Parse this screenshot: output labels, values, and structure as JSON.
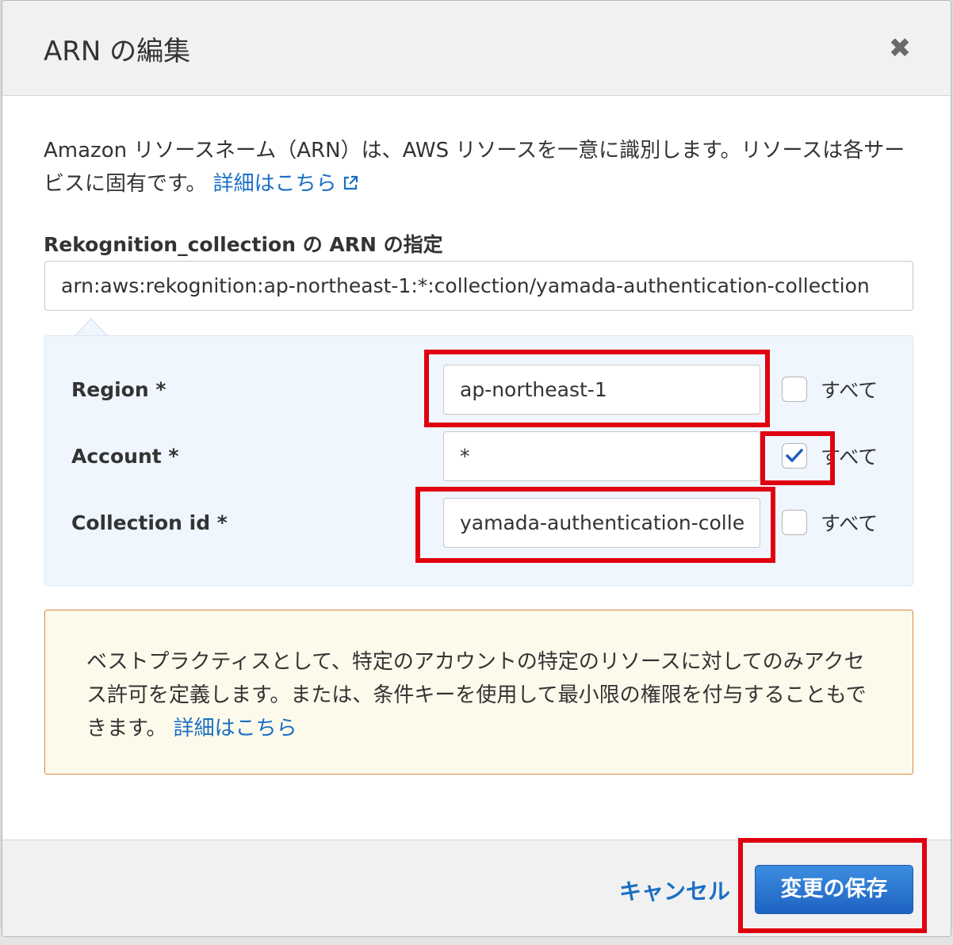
{
  "dialog": {
    "title": "ARN の編集",
    "close_symbol": "✖"
  },
  "description": {
    "text": "Amazon リソースネーム（ARN）は、AWS リソースを一意に識別します。リソースは各サービスに固有です。",
    "link_text": "詳細はこちら"
  },
  "arn_field": {
    "label": "Rekognition_collection の ARN の指定",
    "value": "arn:aws:rekognition:ap-northeast-1:*:collection/yamada-authentication-collection"
  },
  "rows": [
    {
      "label": "Region *",
      "value": "ap-northeast-1",
      "all_checked": false,
      "all_label": "すべて"
    },
    {
      "label": "Account *",
      "value": "*",
      "all_checked": true,
      "all_label": "すべて"
    },
    {
      "label": "Collection id *",
      "value": "yamada-authentication-colle",
      "all_checked": false,
      "all_label": "すべて"
    }
  ],
  "notice": {
    "text": "ベストプラクティスとして、特定のアカウントの特定のリソースに対してのみアクセス許可を定義します。または、条件キーを使用して最小限の権限を付与することもできます。",
    "link_text": "詳細はこちら"
  },
  "footer": {
    "cancel_label": "キャンセル",
    "save_label": "変更の保存"
  },
  "colors": {
    "highlight": "#e00010",
    "link": "#1a6fc4",
    "primary_button": "#1d63c2"
  },
  "icons": {
    "close": "close-icon",
    "external_link": "external-link-icon",
    "checkmark": "checkmark-icon"
  }
}
